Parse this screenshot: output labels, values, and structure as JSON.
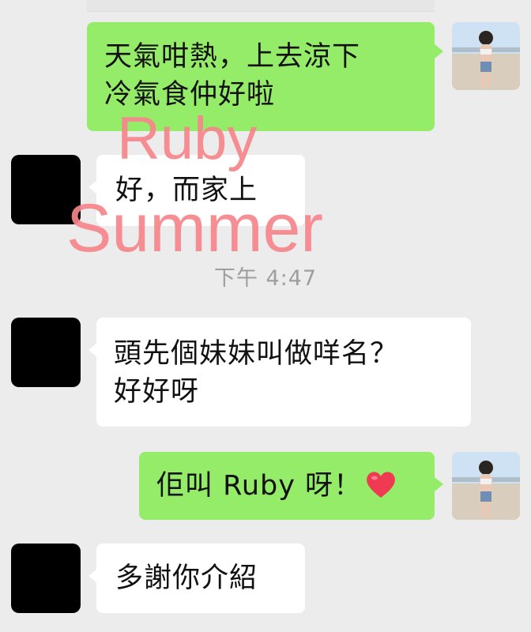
{
  "messages": [
    {
      "side": "right",
      "text_lines": [
        "天氣咁熱，上去涼下",
        "冷氣食仲好啦"
      ]
    },
    {
      "side": "left",
      "text": "好，而家上"
    },
    {
      "side": "left",
      "text_lines": [
        "頭先個妹妹叫做咩名？",
        "好好呀"
      ]
    },
    {
      "side": "right",
      "text": "佢叫 Ruby 呀！",
      "emoji": "heart-icon"
    },
    {
      "side": "left",
      "text": "多謝你介紹"
    }
  ],
  "timestamp": "下午 4:47",
  "watermark": {
    "line1": "Ruby",
    "line2": "Summer"
  },
  "colors": {
    "sent_bubble": "#95ec69",
    "received_bubble": "#ffffff",
    "background": "#ececec",
    "watermark": "#f6868c",
    "timestamp": "#9e9e9e"
  }
}
